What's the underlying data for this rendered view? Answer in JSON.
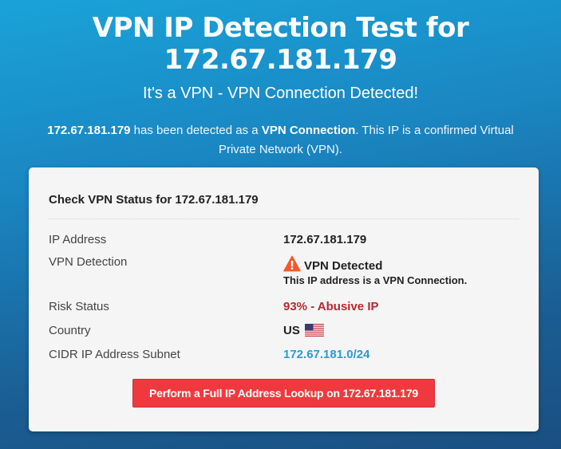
{
  "hero": {
    "title_line1": "VPN IP Detection Test for",
    "title_line2": "172.67.181.179",
    "subtitle": "It's a VPN - VPN Connection Detected!",
    "desc_ip": "172.67.181.179",
    "desc_mid": " has been detected as a ",
    "desc_bold": "VPN Connection",
    "desc_end": ". This IP is a confirmed Virtual Private Network (VPN)."
  },
  "card": {
    "header": "Check VPN Status for 172.67.181.179",
    "rows": {
      "ip": {
        "label": "IP Address",
        "value": "172.67.181.179"
      },
      "vpn": {
        "label": "VPN Detection",
        "value": "VPN Detected",
        "sub": "This IP address is a VPN Connection.",
        "icon": "warning-icon"
      },
      "risk": {
        "label": "Risk Status",
        "value": "93% - Abusive IP",
        "color": "#b8282c"
      },
      "country": {
        "label": "Country",
        "value": "US",
        "icon": "us-flag-icon"
      },
      "cidr": {
        "label": "CIDR IP Address Subnet",
        "value": "172.67.181.0/24",
        "color": "#2a9bd6"
      }
    },
    "button_label": "Perform a Full IP Address Lookup on 172.67.181.179",
    "button_color": "#f0393e"
  }
}
